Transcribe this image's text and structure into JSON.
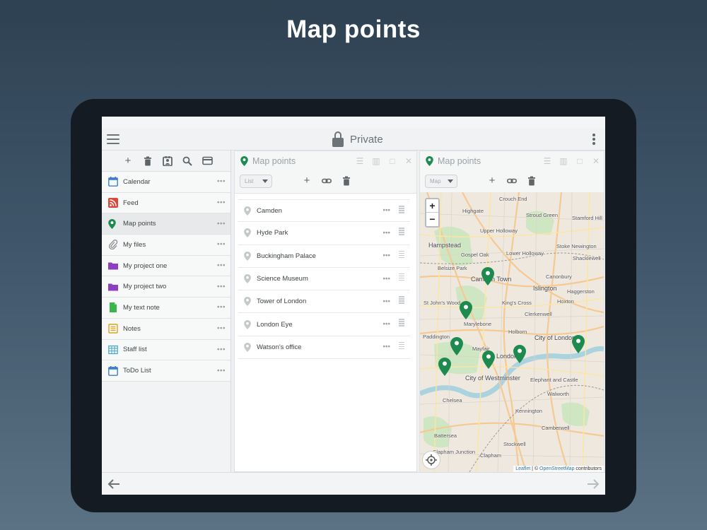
{
  "headline": "Map points",
  "topbar": {
    "title": "Private"
  },
  "sidebar": {
    "toolbar": [
      "add-icon",
      "trash-icon",
      "contact-card-icon",
      "search-icon",
      "card-icon"
    ],
    "items": [
      {
        "label": "Calendar",
        "icon": "calendar-icon",
        "color": "#3b7fd0"
      },
      {
        "label": "Feed",
        "icon": "rss-icon",
        "color": "#d9483b"
      },
      {
        "label": "Map points",
        "icon": "map-pin-icon",
        "color": "#1f8a4f"
      },
      {
        "label": "My files",
        "icon": "paperclip-icon",
        "color": "#8a8f93"
      },
      {
        "label": "My project one",
        "icon": "folder-icon",
        "color": "#8e3fc0"
      },
      {
        "label": "My project two",
        "icon": "folder-icon",
        "color": "#8e3fc0"
      },
      {
        "label": "My text note",
        "icon": "document-icon",
        "color": "#39b54a"
      },
      {
        "label": "Notes",
        "icon": "notes-icon",
        "color": "#e0a21a"
      },
      {
        "label": "Staff list",
        "icon": "table-icon",
        "color": "#3fa6c8"
      },
      {
        "label": "ToDo List",
        "icon": "calendar-icon",
        "color": "#3b7fd0"
      }
    ]
  },
  "list_panel": {
    "title": "Map points",
    "view_select": "List",
    "items": [
      "Camden",
      "Hyde Park",
      "Buckingham Palace",
      "Science Museum",
      "Tower of London",
      "London Eye",
      "Watson's office"
    ]
  },
  "map_panel": {
    "title": "Map points",
    "view_select": "Map",
    "zoom_in": "+",
    "zoom_out": "−",
    "attribution_leaflet": "Leaflet",
    "attribution_sep": " | © ",
    "attribution_osm": "OpenStreetMap",
    "attribution_tail": " contributors",
    "labels": {
      "crouch_end": "Crouch End",
      "stroud_green": "Stroud Green",
      "stamford_hill": "Stamford Hill",
      "highgate": "Highgate",
      "upper_holloway": "Upper Holloway",
      "hampstead": "Hampstead",
      "gospel_oak": "Gospel Oak",
      "lower_holloway": "Lower Holloway",
      "stoke_newington": "Stoke Newington",
      "shacklewell": "Shacklewell",
      "belsize_park": "Belsize Park",
      "camden_town": "Camden Town",
      "canonbury": "Canonbury",
      "islington": "Islington",
      "haggerston": "Haggerston",
      "st_johns_wood": "St John's Wood",
      "kings_cross": "King's Cross",
      "hoxton": "Hoxton",
      "clerkenwell": "Clerkenwell",
      "marylebone": "Marylebone",
      "holborn": "Holborn",
      "city_of_london": "City of London",
      "paddington": "Paddington",
      "mayfair": "Mayfair",
      "london": "London",
      "city_of_westminster": "City of Westminster",
      "elephant_castle": "Elephant and Castle",
      "chelsea": "Chelsea",
      "walworth": "Walworth",
      "kennington": "Kennington",
      "battersea": "Battersea",
      "camberwell": "Camberwell",
      "stockwell": "Stockwell",
      "clapham_junction": "Clapham Junction",
      "clapham": "Clapham"
    }
  },
  "accent_color": "#1f8a4f"
}
